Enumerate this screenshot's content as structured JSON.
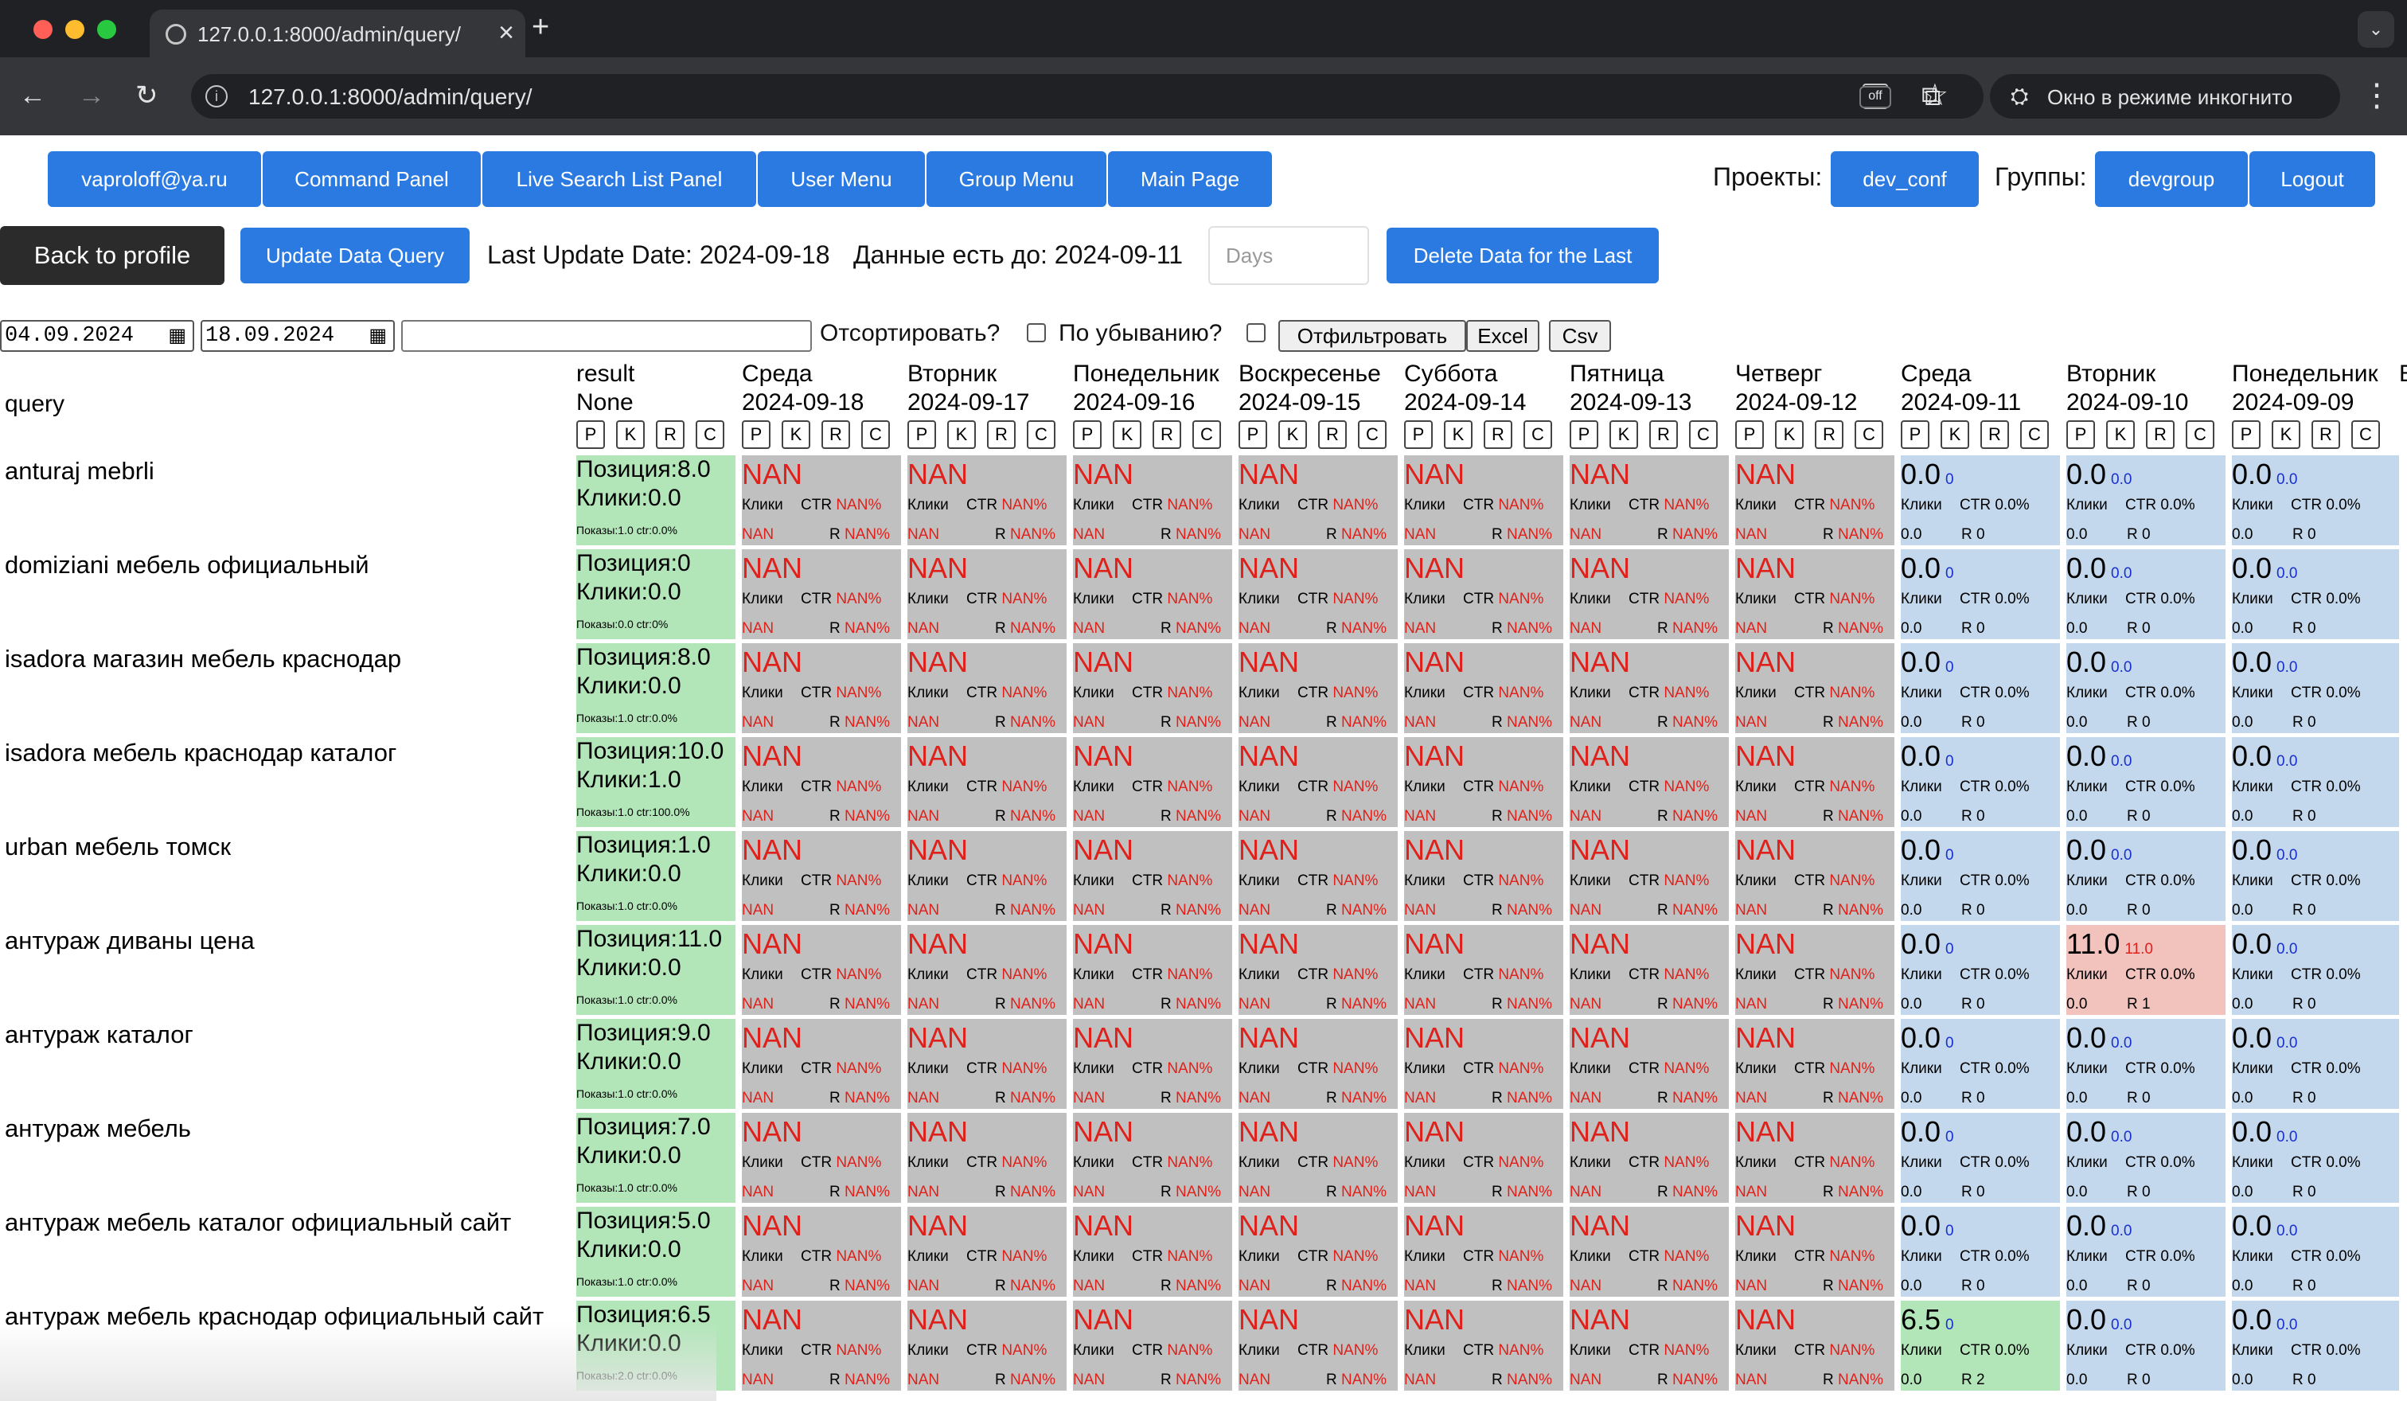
{
  "browser": {
    "tab_title": "127.0.0.1:8000/admin/query/",
    "url": "127.0.0.1:8000/admin/query/",
    "incognito_label": "Окно в режиме инкогнито",
    "extension_badge": "off"
  },
  "nav": {
    "user": "vaproloff@ya.ru",
    "command_panel": "Command Panel",
    "live_search": "Live Search List Panel",
    "user_menu": "User Menu",
    "group_menu": "Group Menu",
    "main_page": "Main Page",
    "projects_label": "Проекты:",
    "project_value": "dev_conf",
    "groups_label": "Группы:",
    "group_value": "devgroup",
    "logout": "Logout"
  },
  "actions": {
    "back": "Back to profile",
    "update": "Update Data Query",
    "last_update": "Last Update Date: 2024-09-18",
    "data_until": "Данные есть до: 2024-09-11",
    "days_placeholder": "Days",
    "delete": "Delete Data for the Last"
  },
  "filters": {
    "date_from": "04.09.2024",
    "date_to": "18.09.2024",
    "sort_label": "Отсортировать?",
    "desc_label": "По убыванию?",
    "filter_btn": "Отфильтровать",
    "excel_btn": "Excel",
    "csv_btn": "Csv"
  },
  "table": {
    "query_header": "query",
    "result_header": [
      "result",
      "None"
    ],
    "pkrc": [
      "P",
      "K",
      "R",
      "C"
    ],
    "columns": [
      {
        "day": "Среда",
        "date": "2024-09-18"
      },
      {
        "day": "Вторник",
        "date": "2024-09-17"
      },
      {
        "day": "Понедельник",
        "date": "2024-09-16"
      },
      {
        "day": "Воскресенье",
        "date": "2024-09-15"
      },
      {
        "day": "Суббота",
        "date": "2024-09-14"
      },
      {
        "day": "Пятница",
        "date": "2024-09-13"
      },
      {
        "day": "Четверг",
        "date": "2024-09-12"
      },
      {
        "day": "Среда",
        "date": "2024-09-11"
      },
      {
        "day": "Вторник",
        "date": "2024-09-10"
      },
      {
        "day": "Понедельник",
        "date": "2024-09-09"
      }
    ],
    "nan_cell": {
      "big": "NAN",
      "clicks": "Клики",
      "ctr": "CTR",
      "ctr_val": "NAN%",
      "bot_left": "NAN",
      "r": "R",
      "r_val": "NAN%"
    },
    "rows": [
      {
        "query": "anturaj mebrli",
        "pos": "Позиция:8.0",
        "clicks": "Клики:0.0",
        "small": "Показы:1.0  ctr:0.0%",
        "d11": {
          "v": "0.0",
          "s": "0",
          "ctr": "CTR 0.0%",
          "b": "0.0",
          "r": "R 0",
          "c": "zero"
        },
        "d10": {
          "v": "0.0",
          "s": "0.0",
          "ctr": "CTR 0.0%",
          "b": "0.0",
          "r": "R 0",
          "c": "zero"
        },
        "d09": {
          "v": "0.0",
          "s": "0.0",
          "ctr": "CTR 0.0%",
          "b": "0.0",
          "r": "R 0",
          "c": "zero"
        }
      },
      {
        "query": "domiziani мебель официальный",
        "pos": "Позиция:0",
        "clicks": "Клики:0.0",
        "small": "Показы:0.0  ctr:0%",
        "d11": {
          "v": "0.0",
          "s": "0",
          "ctr": "CTR 0.0%",
          "b": "0.0",
          "r": "R 0",
          "c": "zero"
        },
        "d10": {
          "v": "0.0",
          "s": "0.0",
          "ctr": "CTR 0.0%",
          "b": "0.0",
          "r": "R 0",
          "c": "zero"
        },
        "d09": {
          "v": "0.0",
          "s": "0.0",
          "ctr": "CTR 0.0%",
          "b": "0.0",
          "r": "R 0",
          "c": "zero"
        }
      },
      {
        "query": "isadora магазин мебель краснодар",
        "pos": "Позиция:8.0",
        "clicks": "Клики:0.0",
        "small": "Показы:1.0  ctr:0.0%",
        "d11": {
          "v": "0.0",
          "s": "0",
          "ctr": "CTR 0.0%",
          "b": "0.0",
          "r": "R 0",
          "c": "zero"
        },
        "d10": {
          "v": "0.0",
          "s": "0.0",
          "ctr": "CTR 0.0%",
          "b": "0.0",
          "r": "R 0",
          "c": "zero"
        },
        "d09": {
          "v": "0.0",
          "s": "0.0",
          "ctr": "CTR 0.0%",
          "b": "0.0",
          "r": "R 0",
          "c": "zero"
        }
      },
      {
        "query": "isadora мебель краснодар каталог",
        "pos": "Позиция:10.0",
        "clicks": "Клики:1.0",
        "small": "Показы:1.0  ctr:100.0%",
        "d11": {
          "v": "0.0",
          "s": "0",
          "ctr": "CTR 0.0%",
          "b": "0.0",
          "r": "R 0",
          "c": "zero"
        },
        "d10": {
          "v": "0.0",
          "s": "0.0",
          "ctr": "CTR 0.0%",
          "b": "0.0",
          "r": "R 0",
          "c": "zero"
        },
        "d09": {
          "v": "0.0",
          "s": "0.0",
          "ctr": "CTR 0.0%",
          "b": "0.0",
          "r": "R 0",
          "c": "zero"
        }
      },
      {
        "query": "urban мебель томск",
        "pos": "Позиция:1.0",
        "clicks": "Клики:0.0",
        "small": "Показы:1.0  ctr:0.0%",
        "d11": {
          "v": "0.0",
          "s": "0",
          "ctr": "CTR 0.0%",
          "b": "0.0",
          "r": "R 0",
          "c": "zero"
        },
        "d10": {
          "v": "0.0",
          "s": "0.0",
          "ctr": "CTR 0.0%",
          "b": "0.0",
          "r": "R 0",
          "c": "zero"
        },
        "d09": {
          "v": "0.0",
          "s": "0.0",
          "ctr": "CTR 0.0%",
          "b": "0.0",
          "r": "R 0",
          "c": "zero"
        }
      },
      {
        "query": "антураж диваны цена",
        "pos": "Позиция:11.0",
        "clicks": "Клики:0.0",
        "small": "Показы:1.0  ctr:0.0%",
        "d11": {
          "v": "0.0",
          "s": "0",
          "ctr": "CTR 0.0%",
          "b": "0.0",
          "r": "R 0",
          "c": "zero"
        },
        "d10": {
          "v": "11.0",
          "s": "11.0",
          "ctr": "CTR 0.0%",
          "b": "0.0",
          "r": "R 1",
          "c": "red"
        },
        "d09": {
          "v": "0.0",
          "s": "0.0",
          "ctr": "CTR 0.0%",
          "b": "0.0",
          "r": "R 0",
          "c": "zero"
        }
      },
      {
        "query": "антураж каталог",
        "pos": "Позиция:9.0",
        "clicks": "Клики:0.0",
        "small": "Показы:1.0  ctr:0.0%",
        "d11": {
          "v": "0.0",
          "s": "0",
          "ctr": "CTR 0.0%",
          "b": "0.0",
          "r": "R 0",
          "c": "zero"
        },
        "d10": {
          "v": "0.0",
          "s": "0.0",
          "ctr": "CTR 0.0%",
          "b": "0.0",
          "r": "R 0",
          "c": "zero"
        },
        "d09": {
          "v": "0.0",
          "s": "0.0",
          "ctr": "CTR 0.0%",
          "b": "0.0",
          "r": "R 0",
          "c": "zero"
        }
      },
      {
        "query": "антураж мебель",
        "pos": "Позиция:7.0",
        "clicks": "Клики:0.0",
        "small": "Показы:1.0  ctr:0.0%",
        "d11": {
          "v": "0.0",
          "s": "0",
          "ctr": "CTR 0.0%",
          "b": "0.0",
          "r": "R 0",
          "c": "zero"
        },
        "d10": {
          "v": "0.0",
          "s": "0.0",
          "ctr": "CTR 0.0%",
          "b": "0.0",
          "r": "R 0",
          "c": "zero"
        },
        "d09": {
          "v": "0.0",
          "s": "0.0",
          "ctr": "CTR 0.0%",
          "b": "0.0",
          "r": "R 0",
          "c": "zero"
        }
      },
      {
        "query": "антураж мебель каталог официальный сайт",
        "pos": "Позиция:5.0",
        "clicks": "Клики:0.0",
        "small": "Показы:1.0  ctr:0.0%",
        "d11": {
          "v": "0.0",
          "s": "0",
          "ctr": "CTR 0.0%",
          "b": "0.0",
          "r": "R 0",
          "c": "zero"
        },
        "d10": {
          "v": "0.0",
          "s": "0.0",
          "ctr": "CTR 0.0%",
          "b": "0.0",
          "r": "R 0",
          "c": "zero"
        },
        "d09": {
          "v": "0.0",
          "s": "0.0",
          "ctr": "CTR 0.0%",
          "b": "0.0",
          "r": "R 0",
          "c": "zero"
        }
      },
      {
        "query": "антураж мебель краснодар официальный сайт",
        "pos": "Позиция:6.5",
        "clicks": "Клики:0.0",
        "small": "Показы:2.0  ctr:0.0%",
        "d11": {
          "v": "6.5",
          "s": "0",
          "ctr": "CTR 0.0%",
          "b": "0.0",
          "r": "R 2",
          "c": "green"
        },
        "d10": {
          "v": "0.0",
          "s": "0.0",
          "ctr": "CTR 0.0%",
          "b": "0.0",
          "r": "R 0",
          "c": "zero"
        },
        "d09": {
          "v": "0.0",
          "s": "0.0",
          "ctr": "CTR 0.0%",
          "b": "0.0",
          "r": "R 0",
          "c": "zero"
        }
      }
    ]
  }
}
